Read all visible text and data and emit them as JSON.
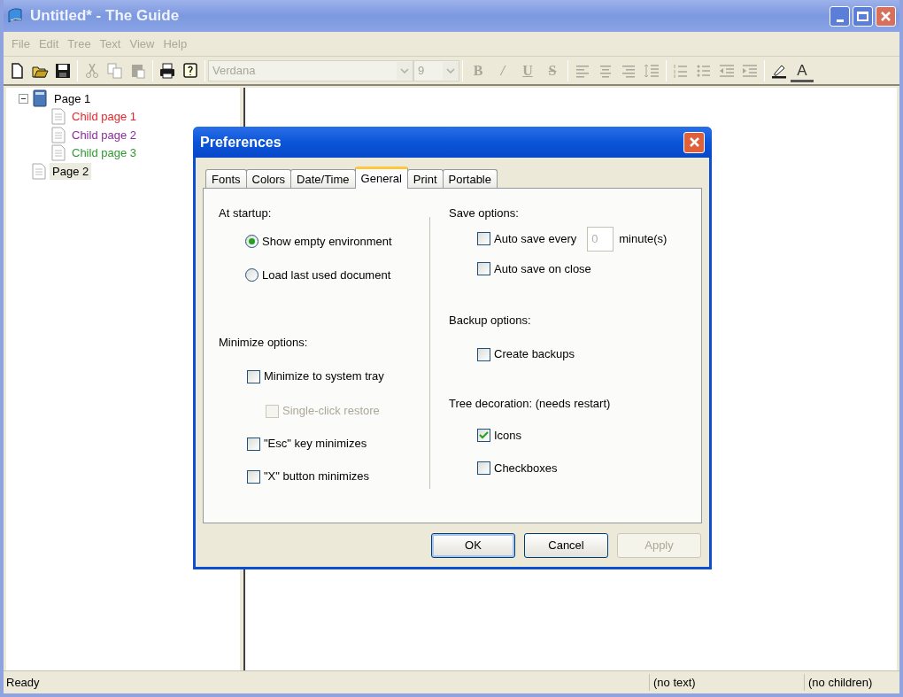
{
  "window": {
    "title": "Untitled* - The Guide"
  },
  "menu": [
    {
      "label": "File",
      "disabled": true
    },
    {
      "label": "Edit",
      "disabled": true
    },
    {
      "label": "Tree",
      "disabled": true
    },
    {
      "label": "Text",
      "disabled": true
    },
    {
      "label": "View",
      "disabled": true
    },
    {
      "label": "Help",
      "disabled": true
    }
  ],
  "toolbar": {
    "file_buttons": [
      {
        "kind": "new",
        "disabled": false
      },
      {
        "kind": "open",
        "disabled": false
      },
      {
        "kind": "save",
        "disabled": false
      }
    ],
    "edit_buttons": [
      {
        "kind": "cut",
        "disabled": true
      },
      {
        "kind": "copy",
        "disabled": true
      },
      {
        "kind": "paste",
        "disabled": true
      }
    ],
    "other_buttons": [
      {
        "kind": "print",
        "disabled": false
      },
      {
        "kind": "help",
        "disabled": false
      }
    ],
    "font_field": {
      "value": "Verdana",
      "disabled": true
    },
    "size_field": {
      "value": "9",
      "disabled": true
    },
    "style_buttons": [
      {
        "label": "B",
        "kind": "bold",
        "disabled": true
      },
      {
        "label": "/",
        "kind": "italic",
        "disabled": true
      },
      {
        "label": "U",
        "kind": "underline",
        "disabled": true
      },
      {
        "label": "S",
        "kind": "strike",
        "disabled": true
      }
    ],
    "align_buttons": [
      {
        "kind": "align-left",
        "disabled": true
      },
      {
        "kind": "align-center",
        "disabled": true
      },
      {
        "kind": "align-right",
        "disabled": true
      },
      {
        "kind": "line-spacing",
        "disabled": true
      }
    ],
    "list_buttons": [
      {
        "kind": "numbered-list",
        "disabled": true
      },
      {
        "kind": "bullet-list",
        "disabled": true
      },
      {
        "kind": "outdent",
        "disabled": true
      },
      {
        "kind": "indent",
        "disabled": true
      }
    ],
    "color_buttons": [
      {
        "kind": "highlight",
        "disabled": false
      },
      {
        "label": "A",
        "kind": "font-color",
        "disabled": false
      }
    ]
  },
  "tree": [
    {
      "label": "Page 1",
      "kind": "book",
      "expanded": true,
      "selected": false,
      "color": "#000000",
      "children": [
        {
          "label": "Child page 1",
          "kind": "page",
          "selected": false,
          "color": "#e8262a"
        },
        {
          "label": "Child page 2",
          "kind": "page",
          "selected": false,
          "color": "#8b2c9c"
        },
        {
          "label": "Child page 3",
          "kind": "page",
          "selected": false,
          "color": "#2e9a2e"
        }
      ]
    },
    {
      "label": "Page 2",
      "kind": "page",
      "selected": true,
      "color": "#000000"
    }
  ],
  "dialog": {
    "title": "Preferences",
    "tabs": [
      {
        "label": "Fonts",
        "selected": false
      },
      {
        "label": "Colors",
        "selected": false
      },
      {
        "label": "Date/Time",
        "selected": false
      },
      {
        "label": "General",
        "selected": true
      },
      {
        "label": "Print",
        "selected": false
      },
      {
        "label": "Portable",
        "selected": false
      }
    ],
    "left_groups": [
      {
        "heading": "At startup:",
        "options": [
          {
            "kind": "radio",
            "label": "Show empty environment",
            "selected": true,
            "disabled": false
          },
          {
            "kind": "radio",
            "label": "Load last used document",
            "selected": false,
            "disabled": false
          }
        ]
      },
      {
        "heading": "Minimize options:",
        "options": [
          {
            "kind": "checkbox",
            "label": "Minimize to system tray",
            "checked": false,
            "disabled": false
          },
          {
            "kind": "checkbox",
            "label": "Single-click restore",
            "checked": false,
            "disabled": true
          },
          {
            "kind": "checkbox",
            "label": "\"Esc\" key minimizes",
            "checked": false,
            "disabled": false
          },
          {
            "kind": "checkbox",
            "label": "\"X\" button minimizes",
            "checked": false,
            "disabled": false
          }
        ]
      }
    ],
    "right_groups": [
      {
        "heading": "Save options:",
        "options": [
          {
            "kind": "interval",
            "label": "Auto save every",
            "checked": false,
            "disabled": false,
            "value": "0",
            "unit": "minute(s)"
          },
          {
            "kind": "checkbox",
            "label": "Auto save on close",
            "checked": false,
            "disabled": false
          }
        ]
      },
      {
        "heading": "Backup options:",
        "options": [
          {
            "kind": "checkbox",
            "label": "Create backups",
            "checked": false,
            "disabled": false
          }
        ]
      },
      {
        "heading": "Tree decoration: (needs restart)",
        "options": [
          {
            "kind": "checkbox",
            "label": "Icons",
            "checked": true,
            "disabled": false
          },
          {
            "kind": "checkbox",
            "label": "Checkboxes",
            "checked": false,
            "disabled": false
          }
        ]
      }
    ],
    "buttons": [
      {
        "label": "OK",
        "default": true,
        "disabled": false
      },
      {
        "label": "Cancel",
        "default": false,
        "disabled": false
      },
      {
        "label": "Apply",
        "default": false,
        "disabled": true
      }
    ]
  },
  "status_bar": {
    "message": "Ready",
    "text_info": "(no text)",
    "children_info": "(no children)"
  }
}
